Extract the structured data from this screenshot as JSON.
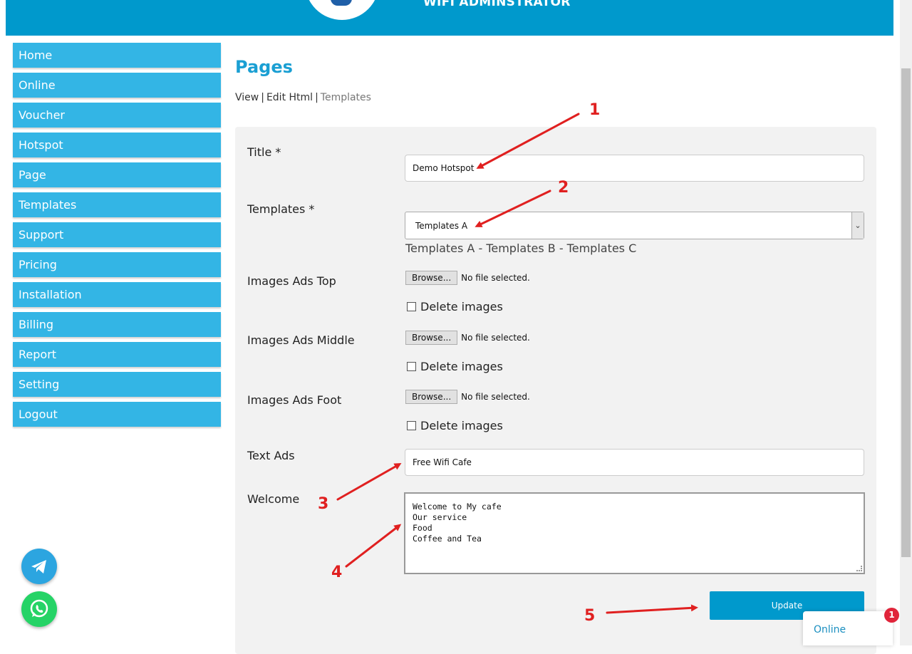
{
  "header": {
    "title": "WIFI ADMINSTRATOR"
  },
  "sidebar": {
    "items": [
      {
        "label": "Home"
      },
      {
        "label": "Online"
      },
      {
        "label": "Voucher"
      },
      {
        "label": "Hotspot"
      },
      {
        "label": "Page"
      },
      {
        "label": "Templates"
      },
      {
        "label": "Support"
      },
      {
        "label": "Pricing"
      },
      {
        "label": "Installation"
      },
      {
        "label": "Billing"
      },
      {
        "label": "Report"
      },
      {
        "label": "Setting"
      },
      {
        "label": "Logout"
      }
    ]
  },
  "main": {
    "page_title": "Pages",
    "sublinks": {
      "view": "View",
      "edit_html": "Edit Html",
      "templates": "Templates",
      "separator": "|"
    },
    "form": {
      "title_label": "Title *",
      "title_value": "Demo Hotspot",
      "templates_label": "Templates *",
      "templates_selected": "Templates A",
      "templates_hint": "Templates A - Templates B - Templates C",
      "ads_top_label": "Images Ads Top",
      "ads_middle_label": "Images Ads Middle",
      "ads_foot_label": "Images Ads Foot",
      "browse_label": "Browse...",
      "no_file_text": "No file selected.",
      "delete_images_label": "Delete images",
      "text_ads_label": "Text Ads",
      "text_ads_value": "Free Wifi Cafe",
      "welcome_label": "Welcome",
      "welcome_lines": [
        "Welcome to My cafe",
        "Our service",
        "Food",
        "Coffee and Tea"
      ],
      "update_label": "Update"
    }
  },
  "annotations": [
    "1",
    "2",
    "3",
    "4",
    "5"
  ],
  "chat": {
    "label": "Online",
    "badge": "1"
  },
  "colors": {
    "header": "#0099cc",
    "nav": "#33b5e5",
    "accent_title": "#1a9fd3",
    "annotation": "#e02020"
  }
}
